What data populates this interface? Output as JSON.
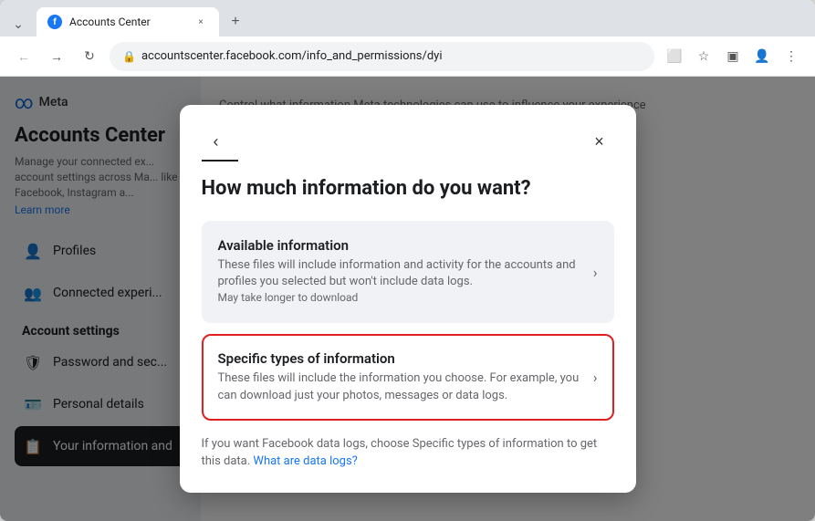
{
  "browser": {
    "tab_title": "Accounts Center",
    "tab_favicon_letter": "f",
    "url": "accountscenter.facebook.com/info_and_permissions/dyi",
    "close_label": "×",
    "new_tab_label": "+"
  },
  "sidebar": {
    "meta_label": "Meta",
    "title": "Accounts Center",
    "description": "Manage your connected ex... account settings across Ma... like Facebook, Instagram a...",
    "learn_more": "Learn more",
    "items": [
      {
        "label": "Profiles",
        "icon": "👤"
      },
      {
        "label": "Connected experi...",
        "icon": "👥"
      }
    ],
    "account_settings_title": "Account settings",
    "settings_items": [
      {
        "label": "Password and sec...",
        "icon": "🛡"
      },
      {
        "label": "Personal details",
        "icon": "🪪"
      },
      {
        "label": "Your information and",
        "icon": "📋",
        "active": true
      }
    ]
  },
  "right_content": {
    "text": "Control what information Meta technologies can use to influence your experience"
  },
  "modal": {
    "title": "How much information do you want?",
    "back_label": "‹",
    "close_label": "×",
    "options": [
      {
        "id": "available",
        "title": "Available information",
        "description": "These files will include information and activity for the accounts and profiles you selected but won't include data logs.",
        "subtitle": "May take longer to download",
        "selected": false,
        "arrow": "›"
      },
      {
        "id": "specific",
        "title": "Specific types of information",
        "description": "These files will include the information you choose. For example, you can download just your photos, messages or data logs.",
        "selected": true,
        "arrow": "›"
      }
    ],
    "footer_text": "If you want Facebook data logs, choose Specific types of information to get this data.",
    "footer_link_text": "What are data logs?",
    "footer_link_url": "#"
  }
}
